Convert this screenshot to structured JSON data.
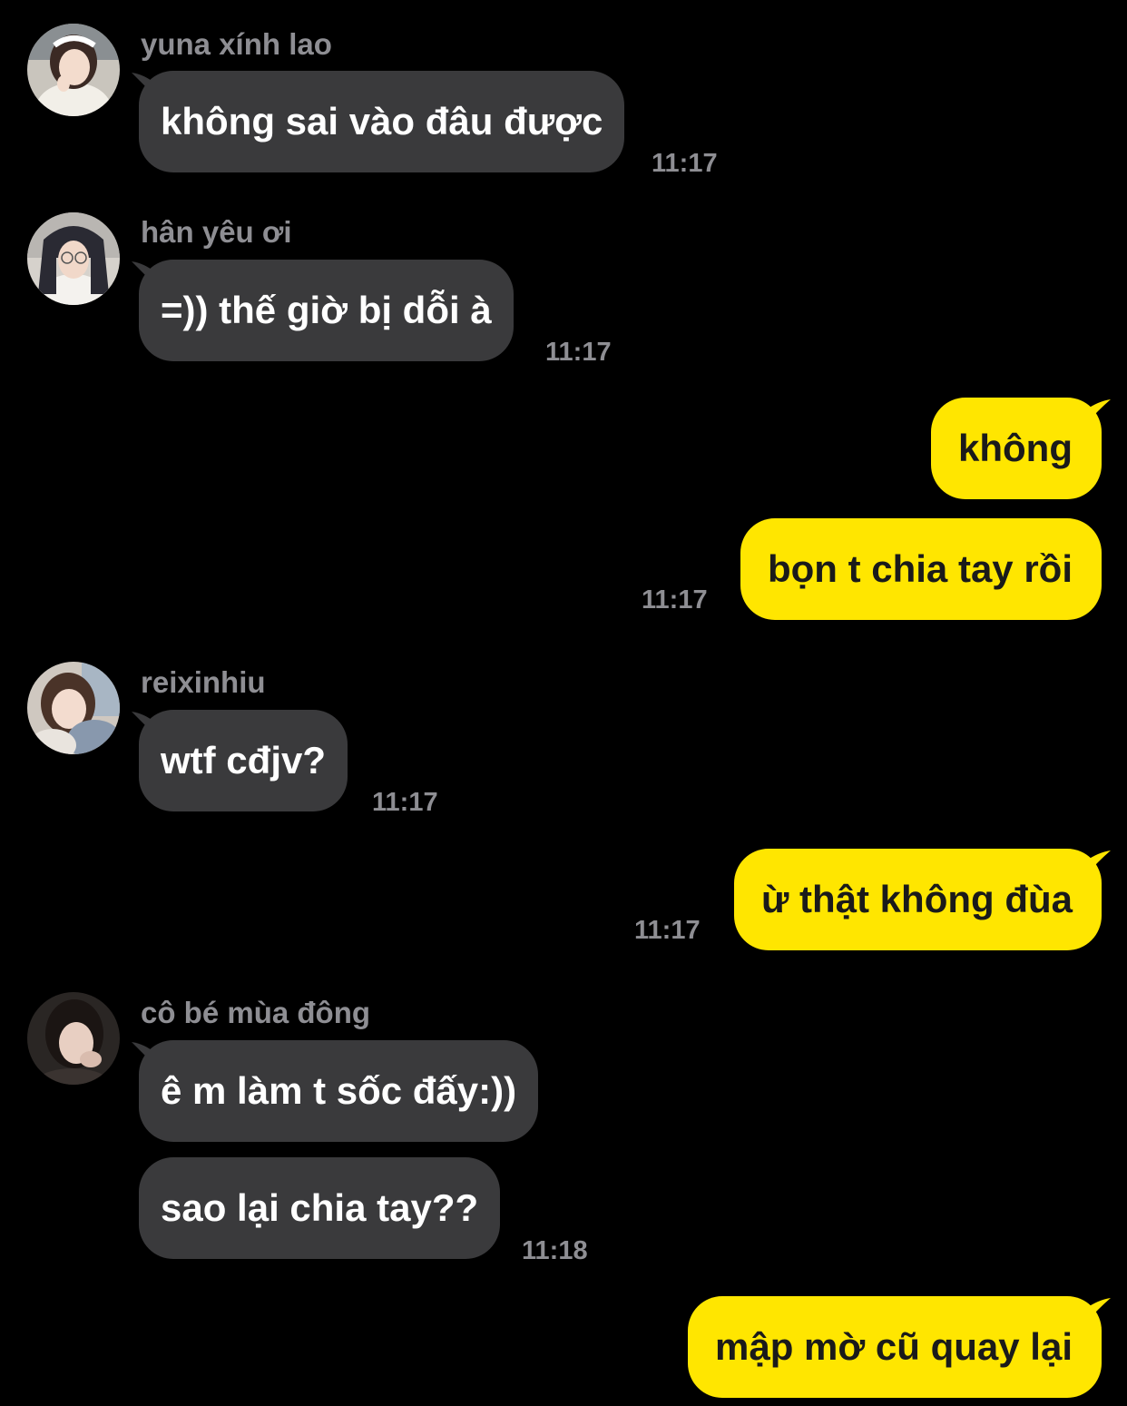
{
  "colors": {
    "background": "#000000",
    "incoming_bubble": "#3a3a3c",
    "outgoing_bubble": "#ffe600",
    "secondary_text": "#8e8e93"
  },
  "messages": [
    {
      "sender": "yuna xính lao",
      "avatar": "avatar-photo",
      "text": "không sai vào đâu được",
      "time": "11:17",
      "direction": "incoming"
    },
    {
      "sender": "hân yêu ơi",
      "avatar": "avatar-photo",
      "text": "=)) thế giờ bị dỗi à",
      "time": "11:17",
      "direction": "incoming"
    },
    {
      "text": "không",
      "direction": "outgoing"
    },
    {
      "text": "bọn t chia tay rồi",
      "time": "11:17",
      "direction": "outgoing"
    },
    {
      "sender": "reixinhiu",
      "avatar": "avatar-photo",
      "text": "wtf cđjv?",
      "time": "11:17",
      "direction": "incoming"
    },
    {
      "text": "ừ thật không đùa",
      "time": "11:17",
      "direction": "outgoing"
    },
    {
      "sender": "cô bé mùa đông",
      "avatar": "avatar-photo",
      "text": "ê m làm t sốc đấy:))",
      "direction": "incoming"
    },
    {
      "text": "sao lại chia tay??",
      "time": "11:18",
      "direction": "incoming"
    },
    {
      "text": "mập mờ cũ quay lại",
      "direction": "outgoing"
    }
  ]
}
